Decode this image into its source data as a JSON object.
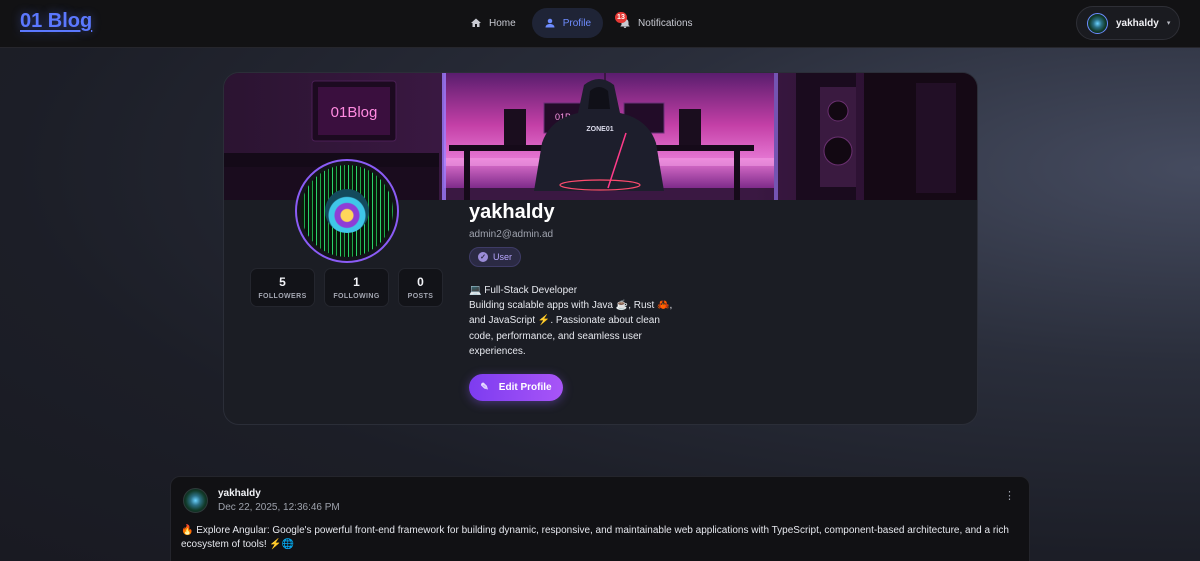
{
  "header": {
    "brand": "01 Blog",
    "nav": [
      {
        "label": "Home",
        "icon": "home-icon"
      },
      {
        "label": "Profile",
        "icon": "person-icon",
        "active": true
      },
      {
        "label": "Notifications",
        "icon": "bell-icon",
        "badge": "13"
      }
    ],
    "user_menu": {
      "username": "yakhaldy",
      "caret": "▾"
    }
  },
  "profile": {
    "banner_sign": "01Blog",
    "banner_jacket": "ZONE01",
    "banner_small_sign": "01B",
    "username": "yakhaldy",
    "email": "admin2@admin.ad",
    "role": "User",
    "stats": [
      {
        "value": "5",
        "label": "FOLLOWERS"
      },
      {
        "value": "1",
        "label": "FOLLOWING"
      },
      {
        "value": "0",
        "label": "POSTS"
      }
    ],
    "bio_lines": [
      "💻 Full-Stack Developer",
      "Building scalable apps with Java ☕, Rust 🦀,",
      "and JavaScript ⚡. Passionate about clean",
      "code, performance, and seamless user",
      "experiences."
    ],
    "edit_label": "Edit Profile"
  },
  "post": {
    "author": "yakhaldy",
    "date": "Dec 22, 2025, 12:36:46 PM",
    "menu_icon": "⋮",
    "content": "🔥 Explore Angular: Google's powerful front-end framework for building dynamic, responsive, and maintainable web applications with TypeScript, component-based architecture, and a rich ecosystem of tools! ⚡🌐"
  },
  "colors": {
    "accent": "#6e8cff",
    "brand": "#5b78ff",
    "purple": "#8b5cf6",
    "badge": "#e53935"
  }
}
